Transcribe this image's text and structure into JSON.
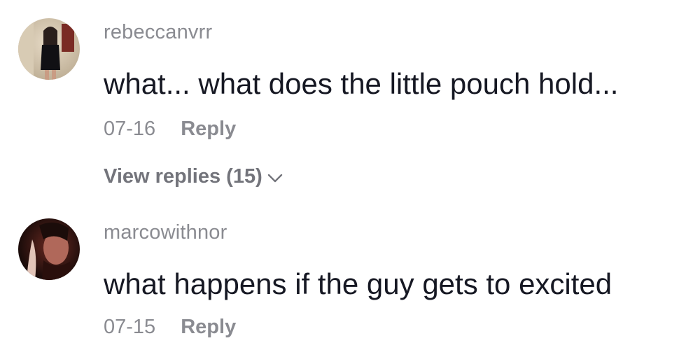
{
  "comments": [
    {
      "username": "rebeccanvrr",
      "text": "what... what does the little pouch hold...",
      "date": "07-16",
      "reply_label": "Reply",
      "view_replies_label": "View replies (15)",
      "avatar_icon": "user-avatar-photo"
    },
    {
      "username": "marcowithnor",
      "text": "what happens if the guy gets to excited",
      "date": "07-15",
      "reply_label": "Reply",
      "avatar_icon": "user-avatar-photo"
    }
  ],
  "colors": {
    "text": "#161823",
    "secondary": "#8a8b91",
    "background": "#ffffff"
  }
}
